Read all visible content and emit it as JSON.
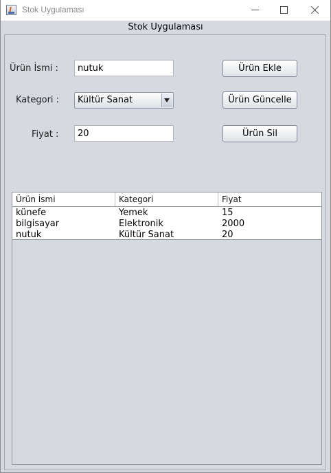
{
  "window": {
    "title": "Stok Uygulaması"
  },
  "panel": {
    "title": "Stok Uygulaması"
  },
  "form": {
    "name_label": "Ürün İsmi :",
    "name_value": "nutuk",
    "category_label": "Kategori :",
    "category_value": "Kültür Sanat",
    "price_label": "Fiyat :",
    "price_value": "20"
  },
  "buttons": {
    "add": "Ürün Ekle",
    "update": "Ürün Güncelle",
    "delete": "Ürün Sil"
  },
  "table": {
    "columns": [
      "Ürün İsmi",
      "Kategori",
      "Fiyat"
    ],
    "rows": [
      [
        "künefe",
        "Yemek",
        "15"
      ],
      [
        "bilgisayar",
        "Elektronik",
        "2000"
      ],
      [
        "nutuk",
        "Kültür Sanat",
        "20"
      ]
    ]
  },
  "colors": {
    "background": "#d6d9df",
    "table_background": "#ffffff"
  }
}
